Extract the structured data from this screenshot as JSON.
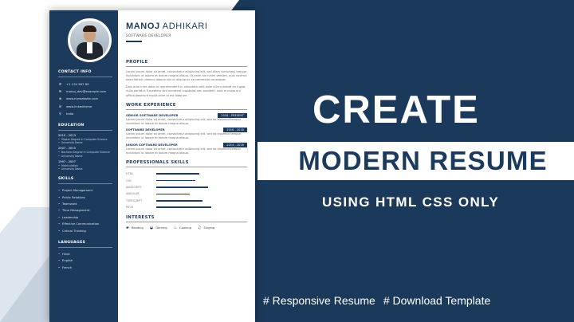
{
  "resume": {
    "name_first": "MANOJ",
    "name_last": "ADHIKARI",
    "role": "SOFTWARE DEVELOPER",
    "contact": {
      "heading": "CONTACT INFO",
      "items": [
        {
          "icon": "phone-icon",
          "glyph": "✆",
          "text": "+1 234 567 89"
        },
        {
          "icon": "email-icon",
          "glyph": "✉",
          "text": "manoj_dev@example.com"
        },
        {
          "icon": "globe-icon",
          "glyph": "⊕",
          "text": "www.mywebsite.com"
        },
        {
          "icon": "linkedin-icon",
          "glyph": "in",
          "text": "www.linkedin/me"
        },
        {
          "icon": "location-icon",
          "glyph": "⚲",
          "text": "India"
        }
      ]
    },
    "education": {
      "heading": "EDUCATION",
      "items": [
        {
          "year": "2010 - 2013",
          "lines": [
            "Master Degree in Computer Science",
            "University Name"
          ]
        },
        {
          "year": "2007 - 2010",
          "lines": [
            "Bachelor Degree in Computer Science",
            "University Name"
          ]
        },
        {
          "year": "1997 - 2007",
          "lines": [
            "Matriculation",
            "University Name"
          ]
        }
      ]
    },
    "skills": {
      "heading": "SKILLS",
      "items": [
        "Project Management",
        "Public Relations",
        "Teamwork",
        "Time Management",
        "Leadership",
        "Effective Communication",
        "Critical Thinking"
      ]
    },
    "languages": {
      "heading": "LANGUAGES",
      "items": [
        "Hindi",
        "English",
        "French"
      ]
    },
    "profile": {
      "heading": "PROFILE",
      "p1": "Lorem ipsum dolor sit amet, consectetur adipiscing elit, sed diam nonummy tempor incididunt ut labore et dolore magna aliqua. Ut enim ad minim veniam, quis nostrud exercitation ullamco laboris nisi ut aliquip ex ea commodo consequat.",
      "p2": "Duis aute irure dolor in reprehenderit in voluptate velit esse cillum dolore eu fugiat nulla pariatur. Excepteur sint occaecat cupidatat non proident, sunt in culpa qui officia deserunt mollit anim id est laborum."
    },
    "experience": {
      "heading": "WORK EXPERIENCE",
      "items": [
        {
          "title": "SENIOR SOFTWARE DEVELOPER",
          "date": "2018 - PRESENT",
          "text": "Lorem ipsum dolor sit amet, consectetur adipiscing elit, sed do eiusmod tempor incididunt ut labore et dolore magna aliqua."
        },
        {
          "title": "SOFTWARE DEVELOPER",
          "date": "2016 - 2018",
          "text": "Lorem ipsum dolor sit amet, consectetur adipiscing elit, sed do eiusmod tempor incididunt ut labore et dolore magna aliqua."
        },
        {
          "title": "JUNIOR SOFTWARE DEVELOPER",
          "date": "2014 - 2016",
          "text": "Lorem ipsum dolor sit amet, consectetur adipiscing elit, sed do eiusmod tempor incididunt ut labore et dolore magna aliqua."
        }
      ]
    },
    "pro_skills": {
      "heading": "PROFESSIONALS SKILLS",
      "items": [
        {
          "name": "HTML",
          "level": 0.75
        },
        {
          "name": "CSS",
          "level": 0.68
        },
        {
          "name": "JAVASCRIPT",
          "level": 0.9
        },
        {
          "name": "ANGULAR",
          "level": 0.58
        },
        {
          "name": "TYPESCRIPT",
          "level": 0.8
        },
        {
          "name": "REUS",
          "level": 0.96
        }
      ]
    },
    "interests": {
      "heading": "INTERESTS",
      "items": [
        {
          "icon": "book-icon",
          "glyph": "▰",
          "label": "Reading"
        },
        {
          "icon": "gamepad-icon",
          "glyph": "◒",
          "label": "Gaming"
        },
        {
          "icon": "cooking-icon",
          "glyph": "♨",
          "label": "Cooking"
        },
        {
          "icon": "music-icon",
          "glyph": "♫",
          "label": "Singing"
        }
      ]
    }
  },
  "hero": {
    "title": "CREATE",
    "banner": "MODERN RESUME",
    "subtitle": "USING HTML CSS ONLY",
    "tag1": "# Responsive Resume",
    "tag2": "# Download Template"
  },
  "colors": {
    "navy": "#1c3a5c",
    "background": "#1b3a5b",
    "white": "#ffffff"
  }
}
